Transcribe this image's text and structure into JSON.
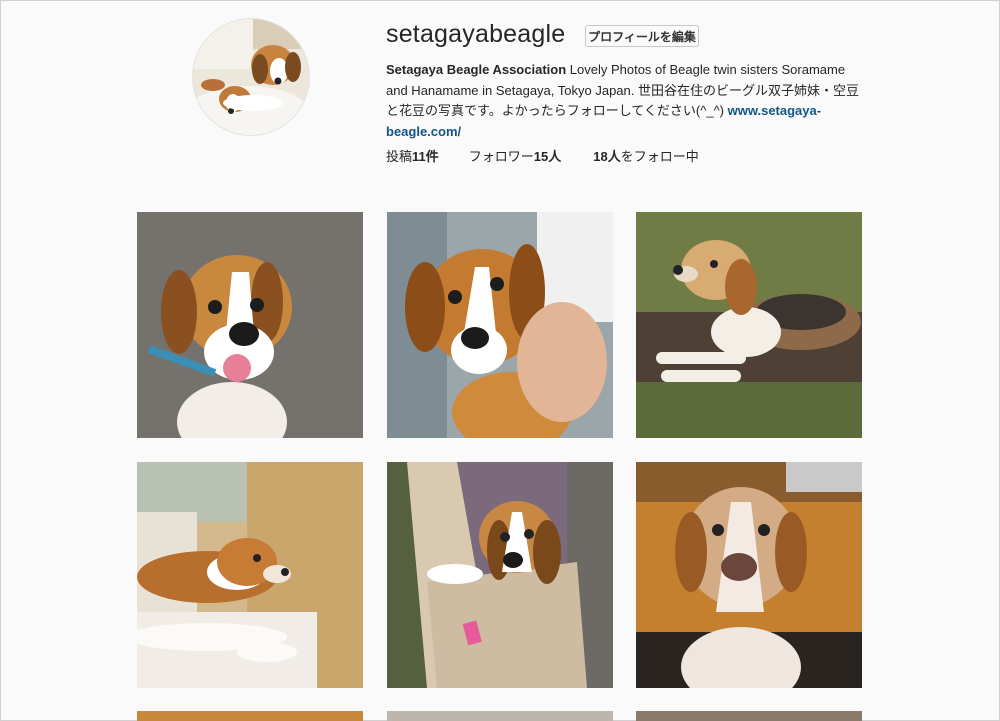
{
  "profile": {
    "username": "setagayabeagle",
    "edit_button": "プロフィールを編集",
    "bio_name": "Setagaya Beagle Association",
    "bio_text": " Lovely Photos of Beagle twin sisters Soramame and Hanamame in Setagaya, Tokyo Japan. 世田谷在住のビーグル双子姉妹・空豆と花豆の写真です。よかったらフォローしてください(^_^) ",
    "bio_link": "www.setagaya-beagle.com/"
  },
  "stats": {
    "posts_label": "投稿",
    "posts_count": "11件",
    "followers_label": "フォロワー",
    "followers_count": "15人",
    "following_count": "18人",
    "following_label": "をフォロー中"
  },
  "colors": {
    "link": "#125688",
    "text": "#262626",
    "background": "#fafafa"
  },
  "icons": {
    "post_thumbnails": "beagle-photo"
  }
}
